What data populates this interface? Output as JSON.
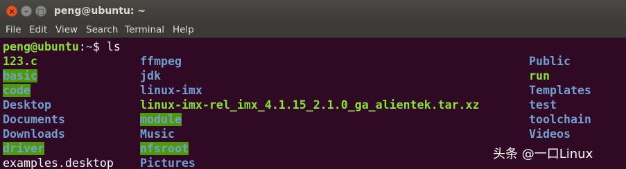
{
  "window": {
    "title": "peng@ubuntu: ~",
    "close_glyph": "×",
    "minimize_glyph": "–",
    "maximize_glyph": "□"
  },
  "menu": {
    "file": "File",
    "edit": "Edit",
    "view": "View",
    "search": "Search",
    "terminal": "Terminal",
    "help": "Help"
  },
  "terminal": {
    "prompt_user": "peng@ubuntu",
    "prompt_colon": ":",
    "prompt_path": "~",
    "prompt_symbol": "$",
    "command": " ls",
    "columns": [
      [
        {
          "name": "123.c",
          "style": "green"
        },
        {
          "name": "basic",
          "style": "dirhl"
        },
        {
          "name": "code",
          "style": "dirhl"
        },
        {
          "name": "Desktop",
          "style": "blue"
        },
        {
          "name": "Documents",
          "style": "blue"
        },
        {
          "name": "Downloads",
          "style": "blue"
        },
        {
          "name": "driver",
          "style": "dirhl"
        },
        {
          "name": "examples.desktop",
          "style": "white"
        }
      ],
      [
        {
          "name": "ffmpeg",
          "style": "blue"
        },
        {
          "name": "jdk",
          "style": "blue"
        },
        {
          "name": "linux-imx",
          "style": "blue"
        },
        {
          "name": "linux-imx-rel_imx_4.1.15_2.1.0_ga_alientek.tar.xz",
          "style": "green"
        },
        {
          "name": "module",
          "style": "dirhl"
        },
        {
          "name": "Music",
          "style": "blue"
        },
        {
          "name": "nfsroot",
          "style": "dirhl"
        },
        {
          "name": "Pictures",
          "style": "blue"
        }
      ],
      [
        {
          "name": "Public",
          "style": "blue"
        },
        {
          "name": "run",
          "style": "green"
        },
        {
          "name": "Templates",
          "style": "blue"
        },
        {
          "name": "test",
          "style": "blue"
        },
        {
          "name": "toolchain",
          "style": "blue"
        },
        {
          "name": "Videos",
          "style": "blue"
        }
      ]
    ]
  },
  "watermark": "头条 @一口Linux",
  "colors": {
    "background": "#300a24",
    "green": "#8ae234",
    "blue": "#729fcf",
    "dir_highlight_bg": "#4e9a06",
    "close_button": "#e95420"
  }
}
